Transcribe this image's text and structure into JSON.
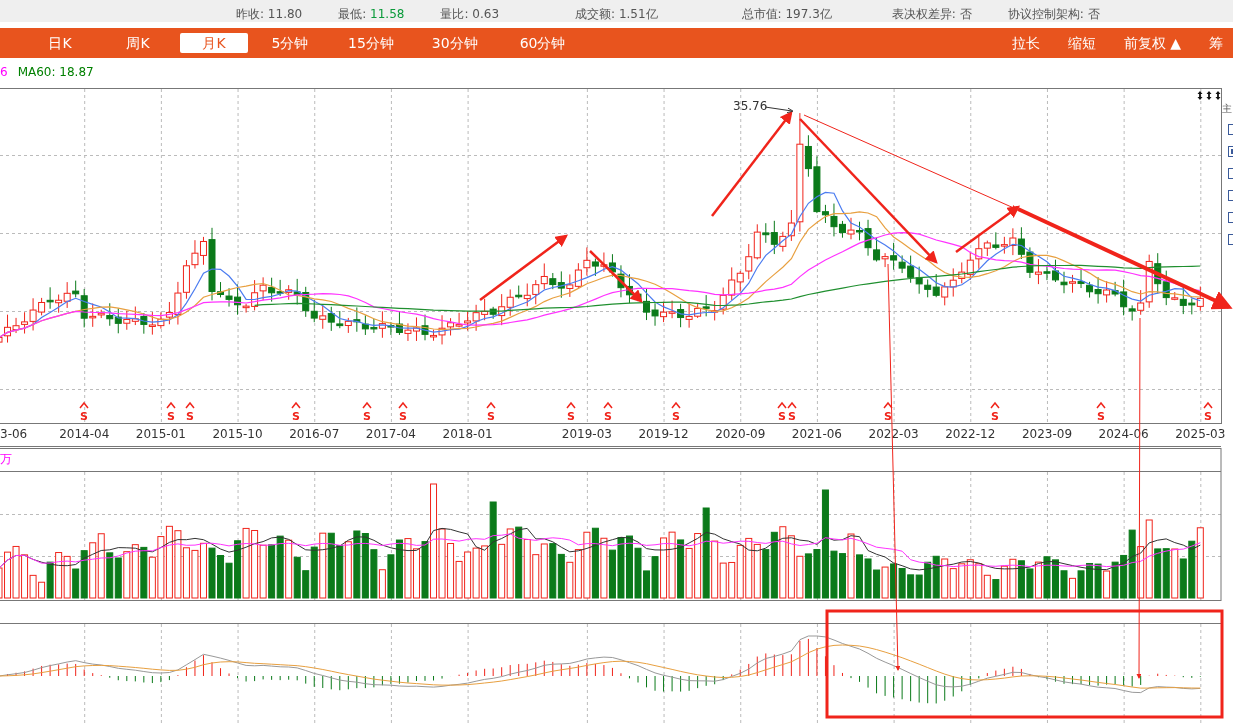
{
  "quote_stats": [
    {
      "label": "昨收:",
      "value": "11.80",
      "kind": "plain"
    },
    {
      "label": "最低:",
      "value": "11.58",
      "kind": "down"
    },
    {
      "label": "量比:",
      "value": "0.63",
      "kind": "plain"
    },
    {
      "label": "成交额:",
      "value": "1.51亿",
      "kind": "plain"
    },
    {
      "label": "总市值:",
      "value": "197.3亿",
      "kind": "plain"
    },
    {
      "label": "表决权差异:",
      "value": "否",
      "kind": "plain"
    },
    {
      "label": "协议控制架构:",
      "value": "否",
      "kind": "plain"
    }
  ],
  "period_tabs": [
    {
      "label": "日K",
      "selected": false
    },
    {
      "label": "周K",
      "selected": false
    },
    {
      "label": "月K",
      "selected": true
    },
    {
      "label": "5分钟",
      "selected": false
    },
    {
      "label": "15分钟",
      "selected": false
    },
    {
      "label": "30分钟",
      "selected": false
    },
    {
      "label": "60分钟",
      "selected": false
    }
  ],
  "chart_tools": [
    "拉长",
    "缩短",
    "前复权 ▲",
    "筹"
  ],
  "legend": [
    {
      "text": "6",
      "color": "#ff00ff"
    },
    {
      "text": "MA60: 18.87",
      "color": "#008000"
    }
  ],
  "peak_label": "35.76",
  "x_axis_labels": [
    "3-06",
    "2014-04",
    "2015-01",
    "2015-10",
    "2016-07",
    "2017-04",
    "2018-01",
    "2019-03",
    "2019-12",
    "2020-09",
    "2021-06",
    "2022-03",
    "2022-12",
    "2023-09",
    "2024-06",
    "2025-03"
  ],
  "dividend_markers": [
    "S",
    "S",
    "S",
    "S",
    "S",
    "S",
    "S",
    "S",
    "S",
    "S",
    "S",
    "S",
    "S",
    "S",
    "S",
    "S"
  ],
  "volume_unit": "万",
  "side_panel": {
    "label": "主",
    "checkboxes": [
      {
        "checked": false
      },
      {
        "checked": true
      },
      {
        "checked": false
      },
      {
        "checked": false
      },
      {
        "checked": false
      },
      {
        "checked": false
      }
    ]
  }
}
